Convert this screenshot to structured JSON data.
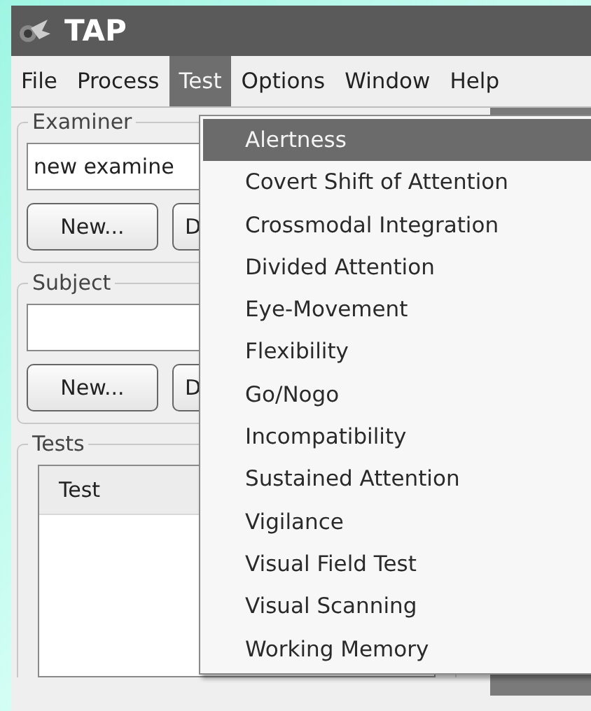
{
  "window": {
    "title": "TAP"
  },
  "menu_bar": [
    {
      "label": "File",
      "selected": false
    },
    {
      "label": "Process",
      "selected": false
    },
    {
      "label": "Test",
      "selected": true
    },
    {
      "label": "Options",
      "selected": false
    },
    {
      "label": "Window",
      "selected": false
    },
    {
      "label": "Help",
      "selected": false
    }
  ],
  "test_menu": {
    "items": [
      {
        "label": "Alertness",
        "selected": true
      },
      {
        "label": "Covert Shift of Attention",
        "selected": false
      },
      {
        "label": "Crossmodal Integration",
        "selected": false
      },
      {
        "label": "Divided Attention",
        "selected": false
      },
      {
        "label": "Eye-Movement",
        "selected": false
      },
      {
        "label": "Flexibility",
        "selected": false
      },
      {
        "label": "Go/Nogo",
        "selected": false
      },
      {
        "label": "Incompatibility",
        "selected": false
      },
      {
        "label": "Sustained Attention",
        "selected": false
      },
      {
        "label": "Vigilance",
        "selected": false
      },
      {
        "label": "Visual Field Test",
        "selected": false
      },
      {
        "label": "Visual Scanning",
        "selected": false
      },
      {
        "label": "Working Memory",
        "selected": false
      }
    ]
  },
  "examiner": {
    "title": "Examiner",
    "value": "new examine",
    "buttons": [
      "New...",
      "D"
    ]
  },
  "subject": {
    "title": "Subject",
    "buttons": [
      "New...",
      "D"
    ]
  },
  "tests": {
    "title": "Tests",
    "columns": [
      "Test"
    ]
  }
}
